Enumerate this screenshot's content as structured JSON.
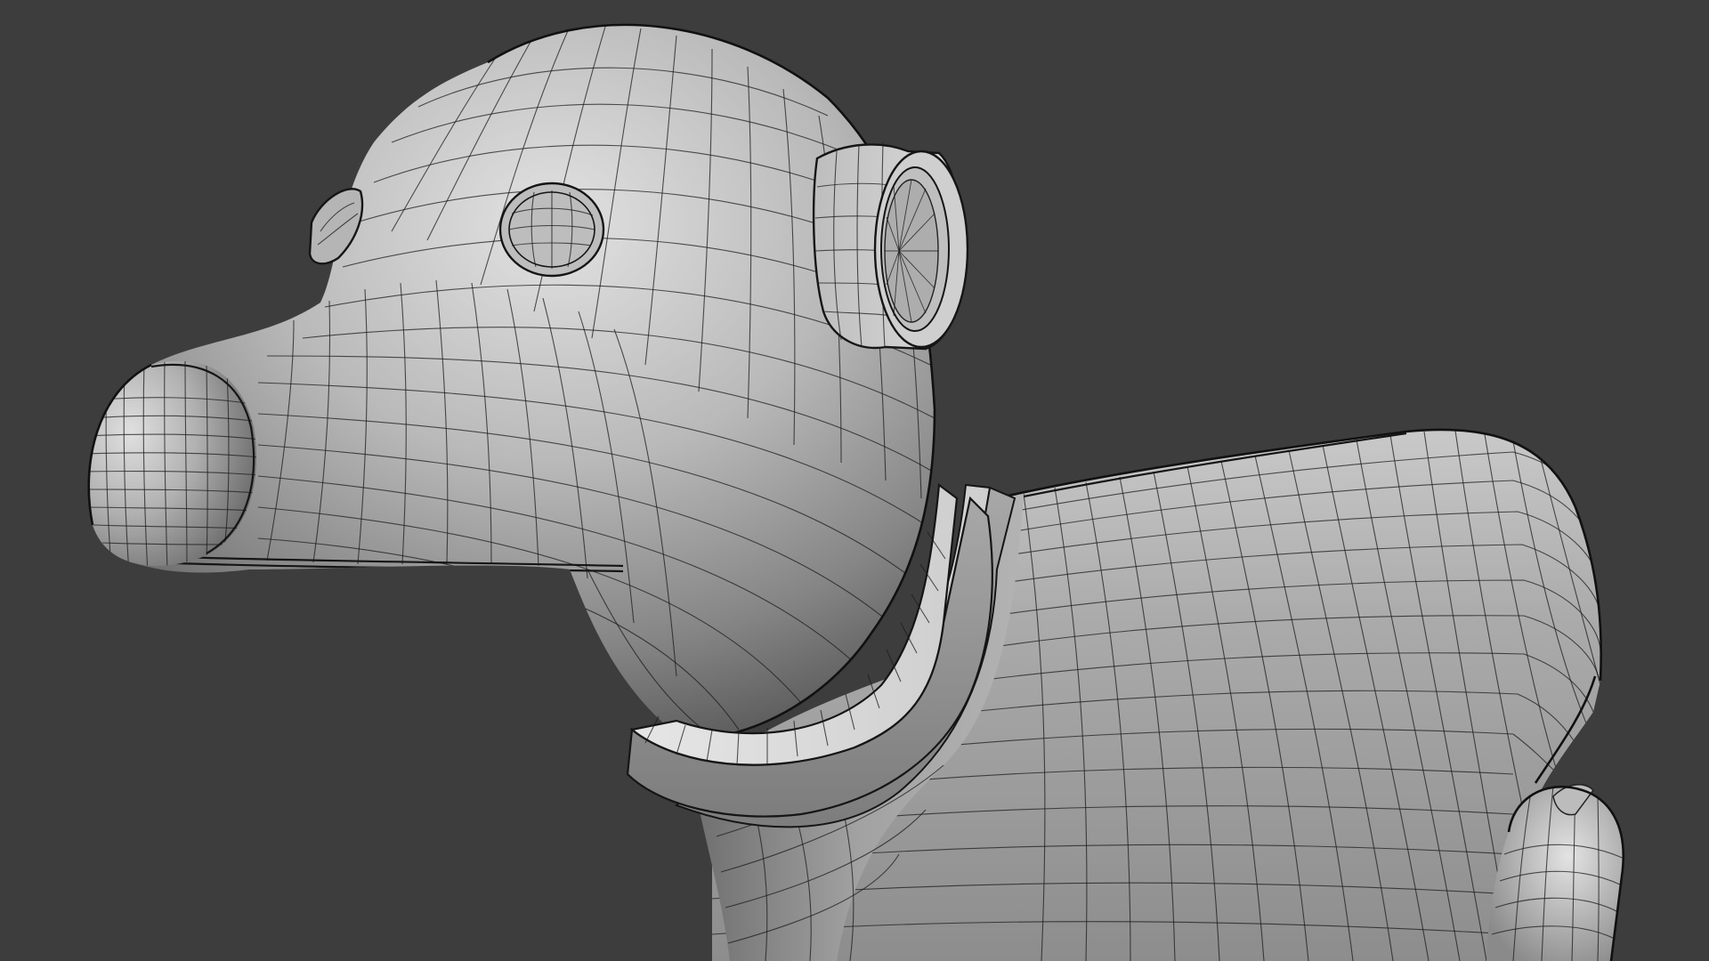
{
  "viewport": {
    "background_color": "#3d3d3d",
    "object": "dog-model",
    "shading": "solid-with-wireframe",
    "surface_color": "#a9a9a9",
    "wire_color": "#1c1c1c"
  }
}
